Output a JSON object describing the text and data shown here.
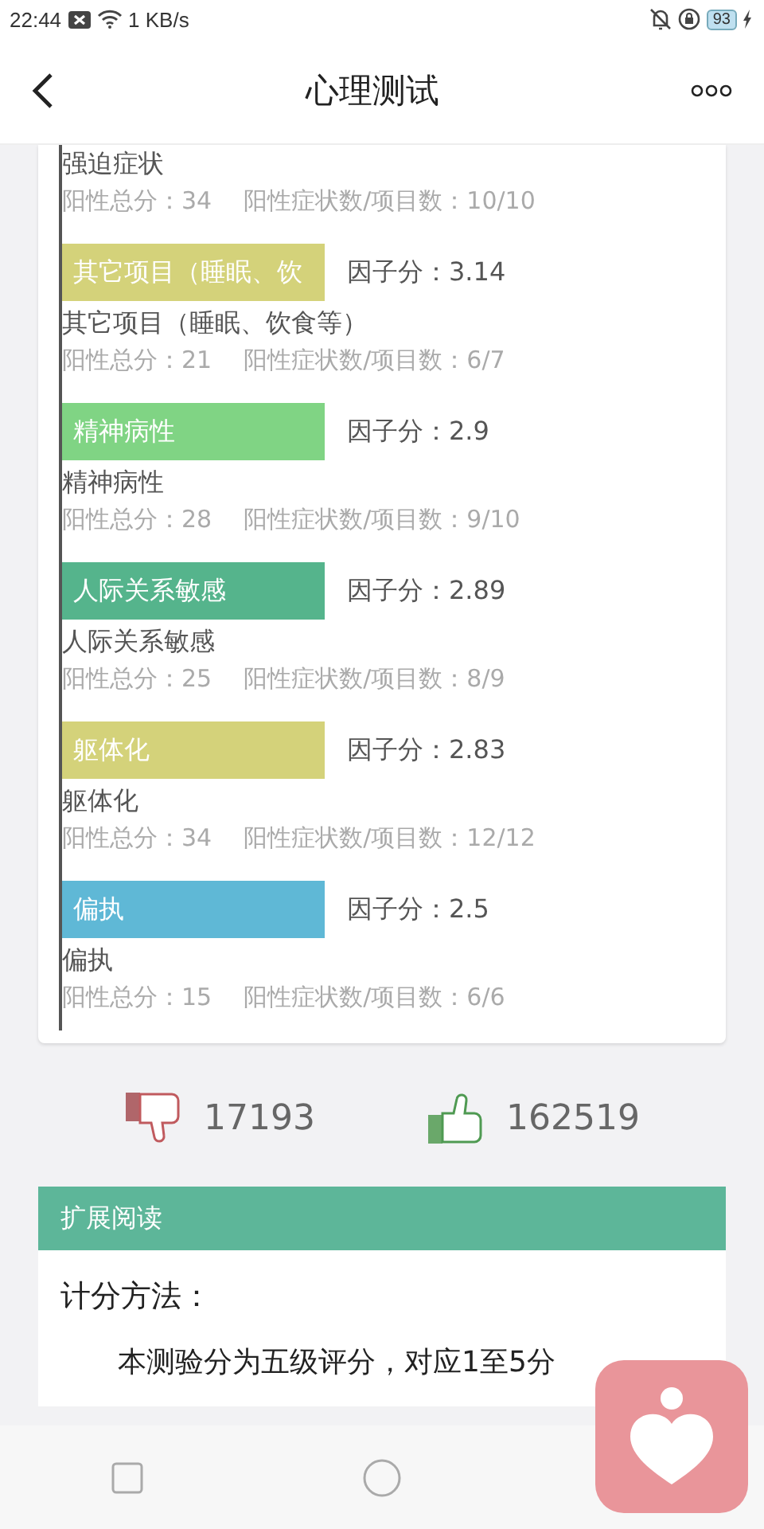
{
  "status_bar": {
    "time": "22:44",
    "speed": "1 KB/s",
    "battery": "93"
  },
  "header": {
    "title": "心理测试"
  },
  "factors": [
    {
      "name": "强迫症状",
      "total": "阳性总分：34",
      "ratio": "阳性症状数/项目数：10/10"
    },
    {
      "label": "其它项目（睡眠、饮",
      "score": "因子分：3.14",
      "color": "#d4d27a",
      "name": "其它项目（睡眠、饮食等）",
      "total": "阳性总分：21",
      "ratio": "阳性症状数/项目数：6/7"
    },
    {
      "label": "精神病性",
      "score": "因子分：2.9",
      "color": "#80d484",
      "name": "精神病性",
      "total": "阳性总分：28",
      "ratio": "阳性症状数/项目数：9/10"
    },
    {
      "label": "人际关系敏感",
      "score": "因子分：2.89",
      "color": "#55b48c",
      "name": "人际关系敏感",
      "total": "阳性总分：25",
      "ratio": "阳性症状数/项目数：8/9"
    },
    {
      "label": "躯体化",
      "score": "因子分：2.83",
      "color": "#d4d27a",
      "name": "躯体化",
      "total": "阳性总分：34",
      "ratio": "阳性症状数/项目数：12/12"
    },
    {
      "label": "偏执",
      "score": "因子分：2.5",
      "color": "#5fb8d6",
      "name": "偏执",
      "total": "阳性总分：15",
      "ratio": "阳性症状数/项目数：6/6"
    }
  ],
  "votes": {
    "down": "17193",
    "up": "162519"
  },
  "extended": {
    "title": "扩展阅读",
    "heading": "计分方法：",
    "paragraph": "本测验分为五级评分，对应1至5分"
  }
}
